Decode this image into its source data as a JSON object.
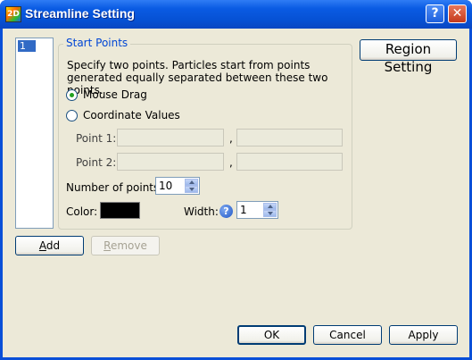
{
  "window": {
    "title": "Streamline Setting",
    "help_btn": "?",
    "close_btn": "✕",
    "app_icon_text": "2D"
  },
  "list": {
    "items": [
      "1"
    ]
  },
  "start_points": {
    "group_title": "Start Points",
    "description": "Specify two points. Particles start from points generated equally separated between these two points.",
    "mode_options": [
      {
        "label": "Mouse Drag",
        "checked": true
      },
      {
        "label": "Coordinate Values",
        "checked": false
      }
    ],
    "point1_label": "Point 1:",
    "point2_label": "Point 2:",
    "separator": ",",
    "point1_x": "",
    "point1_y": "",
    "point2_x": "",
    "point2_y": "",
    "num_points_label": "Number of points:",
    "num_points_value": "10",
    "color_label": "Color:",
    "color_value": "#000000",
    "width_label": "Width:",
    "width_value": "1"
  },
  "buttons": {
    "region_setting": "Region Setting",
    "add": "Add",
    "remove": "Remove",
    "ok": "OK",
    "cancel": "Cancel",
    "apply": "Apply"
  },
  "colors": {
    "titlebar": "#0a5be3",
    "face": "#ece9d8",
    "group_title": "#0046d5",
    "selection": "#316ac5"
  }
}
